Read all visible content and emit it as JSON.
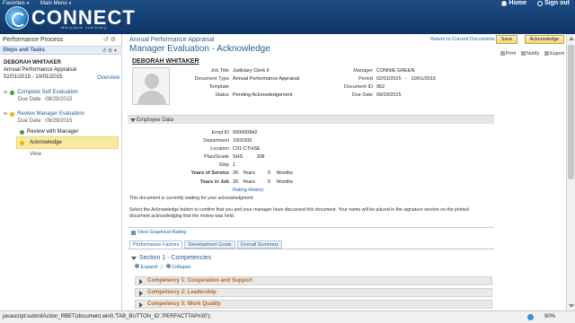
{
  "topbar": {
    "menus": [
      "Favorites",
      "Main Menu"
    ],
    "logo_text": "CONNECT",
    "logo_sub": "Maryland Judiciary",
    "home_label": "Home",
    "signout_label": "Sign out"
  },
  "left": {
    "title": "Performance Process",
    "tools": "↺  ⚙",
    "bar_label": "Steps and Tasks",
    "bar_tools": "↺  ⚙ ▾",
    "employee": "DEBORAH WHITAKER",
    "doc": "Annual Performance Appraisal",
    "dates": "02/01/2015  -  10/01/2015",
    "overview": "Overview",
    "steps": [
      {
        "label": "Complete Self Evaluation",
        "due_label": "Due Date",
        "due": "08/29/2015"
      },
      {
        "label": "Review Manager Evaluation",
        "due_label": "Due Date",
        "due": "09/29/2015"
      }
    ],
    "sub_review": "Review with Manager",
    "ack": "Acknowledge",
    "view": "View"
  },
  "main": {
    "crumb": "Annual Performance Appraisal",
    "title": "Manager Evaluation - Acknowledge",
    "return_link": "Return to Current Documents",
    "save": "Save",
    "acknowledge": "Acknowledge",
    "actions": [
      "Print",
      "Notify",
      "Export"
    ],
    "name": "DEBORAH WHITAKER",
    "fields_left": [
      {
        "label": "Job Title",
        "value": "Judiciary Clerk II"
      },
      {
        "label": "Document Type",
        "value": "Annual Performance Appraisal"
      },
      {
        "label": "Template",
        "value": ""
      },
      {
        "label": "Status",
        "value": "Pending Acknowledgement"
      }
    ],
    "fields_right": [
      {
        "label": "Manager",
        "value": "CONNIE GREEN"
      },
      {
        "label": "Period",
        "value": "02/01/2015   -   10/01/2015"
      },
      {
        "label": "Document ID",
        "value": "952"
      },
      {
        "label": "Due Date",
        "value": "09/29/2015"
      }
    ],
    "employee_data_label": "Employee Data",
    "emp_fields": [
      {
        "label": "Empl ID",
        "value": "000000842"
      },
      {
        "label": "Department",
        "value": "1001000"
      },
      {
        "label": "Location",
        "value": "C01-CTHSE"
      },
      {
        "label": "Plan/Grade",
        "value": "SHS          J08"
      },
      {
        "label": "Step",
        "value": "1"
      }
    ],
    "yos_label": "Years of Service",
    "yos_years": "26",
    "yos_months": "0",
    "yij_label": "Years in Job",
    "yij_years": "26",
    "yij_months": "0",
    "years_word": "Years",
    "months_word": "Months",
    "rating_history": "Rating History",
    "para1": "This document is currently waiting for your acknowledgment.",
    "para2": "Select the Acknowledge button to confirm that you and your manager have discussed this document. Your name will be placed in the signature section on the printed document acknowledging that the review was held.",
    "view_graphical": "View Graphical Rating",
    "tabs": [
      "Performance Factors",
      "Development Goals",
      "Overall Summary"
    ],
    "section1": "Section 1 - Competencies",
    "expand": "Expand",
    "collapse": "Collapse",
    "competencies": [
      "Competency 1: Cooperation and Support",
      "Competency 2: Leadership",
      "Competency 3: Work Quality"
    ]
  },
  "status": {
    "text": "javascript:submitAction_RBET(document.win0,'TAB_BUTTON_ID','PERFACTTAP#30');",
    "zoom": "90%"
  }
}
